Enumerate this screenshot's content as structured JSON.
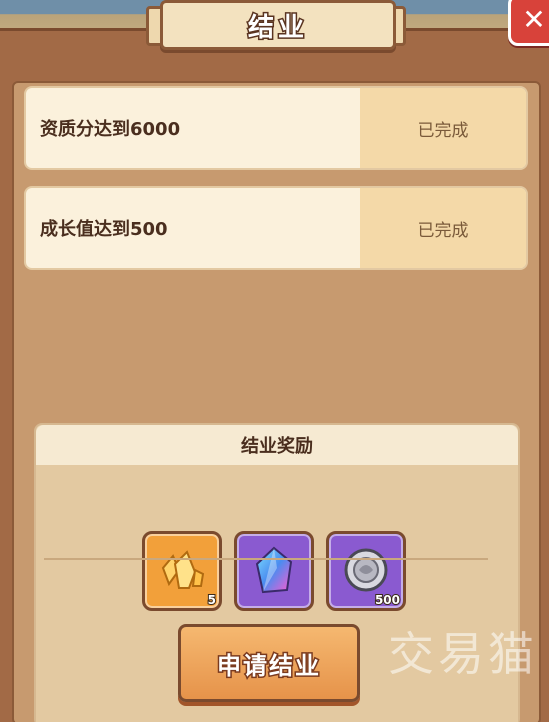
{
  "title": "结业",
  "close_label": "✕",
  "tasks": [
    {
      "label": "资质分达到6000",
      "status": "已完成"
    },
    {
      "label": "成长值达到500",
      "status": "已完成"
    }
  ],
  "reward": {
    "header": "结业奖励",
    "items": [
      {
        "icon": "gold-crystal-icon",
        "count": "5",
        "color": "#f2a03a"
      },
      {
        "icon": "rainbow-crystal-icon",
        "count": "",
        "color": "#8a5ad0"
      },
      {
        "icon": "silver-coin-icon",
        "count": "500",
        "color": "#8a5ad0"
      }
    ]
  },
  "apply_button": "申请结业",
  "watermark": "交易猫"
}
